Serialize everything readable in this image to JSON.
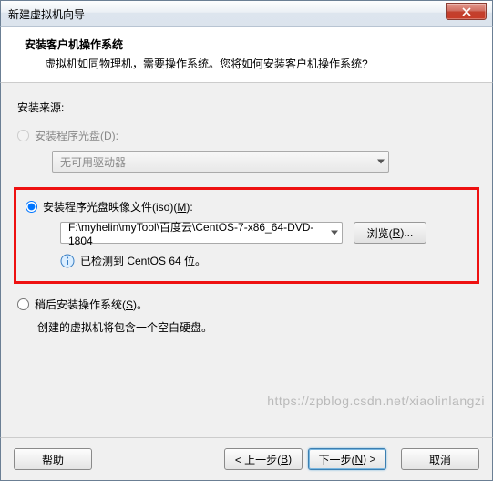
{
  "window": {
    "title": "新建虚拟机向导"
  },
  "header": {
    "title": "安装客户机操作系统",
    "subtitle": "虚拟机如同物理机，需要操作系统。您将如何安装客户机操作系统?"
  },
  "source": {
    "label": "安装来源:",
    "opt_disc": {
      "label_pre": "安装程序光盘(",
      "key": "D",
      "label_post": "):",
      "drive_text": "无可用驱动器"
    },
    "opt_iso": {
      "label_pre": "安装程序光盘映像文件(iso)(",
      "key": "M",
      "label_post": "):",
      "path": "F:\\myhelin\\myTool\\百度云\\CentOS-7-x86_64-DVD-1804",
      "browse_pre": "浏览(",
      "browse_key": "R",
      "browse_post": ")...",
      "detected": "已检测到 CentOS 64 位。"
    },
    "opt_later": {
      "label_pre": "稍后安装操作系统(",
      "key": "S",
      "label_post": ")。",
      "note": "创建的虚拟机将包含一个空白硬盘。"
    }
  },
  "footer": {
    "help": "帮助",
    "back_pre": "< 上一步(",
    "back_key": "B",
    "back_post": ")",
    "next_pre": "下一步(",
    "next_key": "N",
    "next_post": ") >",
    "cancel": "取消"
  },
  "watermark": "https://zpblog.csdn.net/xiaolinlangzi"
}
